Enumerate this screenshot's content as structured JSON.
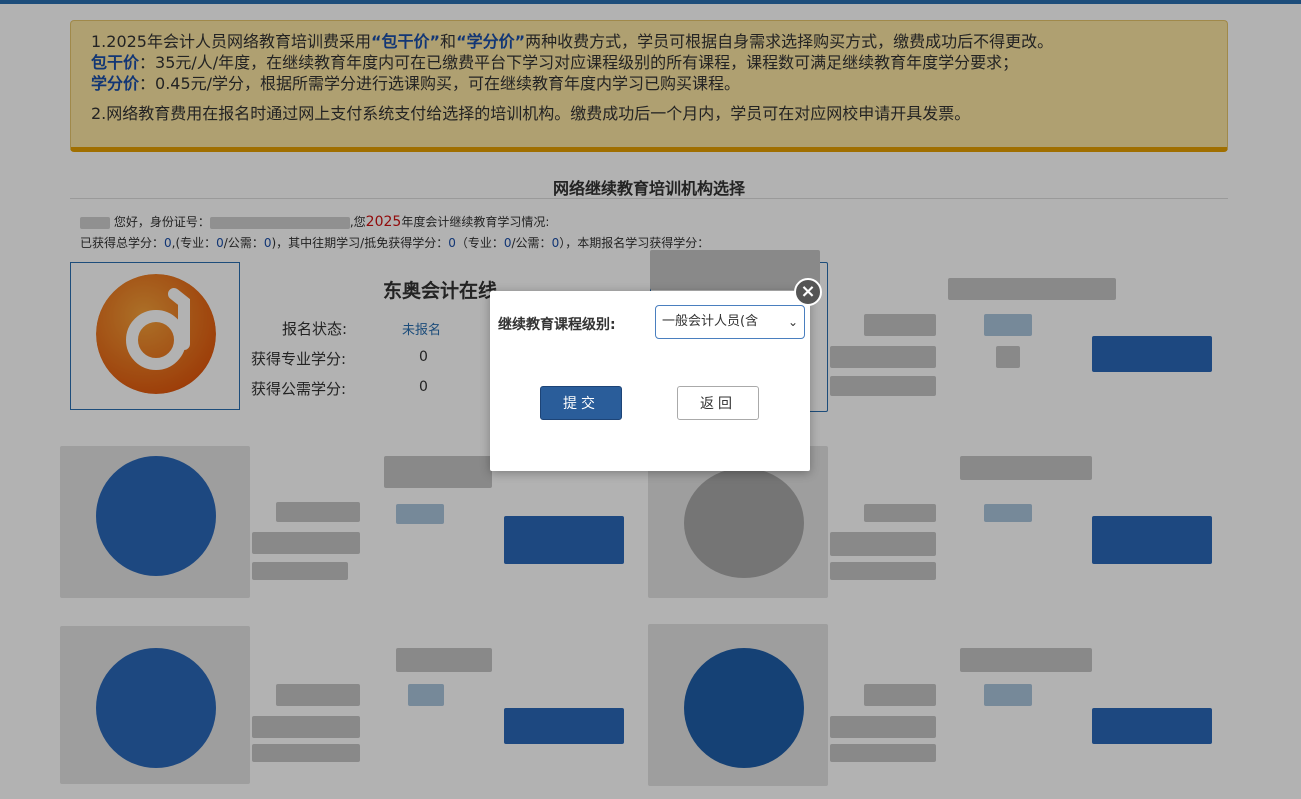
{
  "notice": {
    "line1_pre": "1.2025年会计人员网络教育培训费采用",
    "line1_hl1": "“包干价”",
    "line1_mid": "和",
    "line1_hl2": "“学分价”",
    "line1_post": "两种收费方式，学员可根据自身需求选择购买方式，缴费成功后不得更改。",
    "line2_label": "包干价",
    "line2_text": "：35元/人/年度，在继续教育年度内可在已缴费平台下学习对应课程级别的所有课程，课程数可满足继续教育年度学分要求；",
    "line3_label": "学分价",
    "line3_text": "：0.45元/学分，根据所需学分进行选课购买，可在继续教育年度内学习已购买课程。",
    "line4": "2.网络教育费用在报名时通过网上支付系统支付给选择的培训机构。缴费成功后一个月内，学员可在对应网校申请开具发票。"
  },
  "section_title": "网络继续教育培训机构选择",
  "user_info": {
    "greeting": "您好，身份证号：",
    "after_id": ",您",
    "year": "2025",
    "after_year": "年度会计继续教育学习情况:",
    "line2_a": "已获得总学分：",
    "total": "0",
    "line2_b": ",(专业：",
    "pro": "0",
    "line2_c": "/公需：",
    "pub": "0",
    "line2_d": ")，其中往期学习/抵免获得学分：",
    "past": "0",
    "line2_e": "（专业：",
    "past_pro": "0",
    "line2_f": "/公需：",
    "past_pub": "0",
    "line2_g": "），本期报名学习获得学分："
  },
  "institution": {
    "name": "东奥会计在线",
    "status_label": "报名状态:",
    "status_value": "未报名",
    "pro_label": "获得专业学分:",
    "pro_value": "0",
    "pub_label": "获得公需学分:",
    "pub_value": "0"
  },
  "modal": {
    "label": "继续教育课程级别:",
    "selected": "一般会计人员(含",
    "submit": "提交",
    "back": "返回",
    "close_glyph": "×"
  },
  "colors": {
    "accent": "#2a5d9a",
    "notice_bg": "#fbe5a2",
    "highlight": "#1a4ea8",
    "year": "#d01010"
  }
}
